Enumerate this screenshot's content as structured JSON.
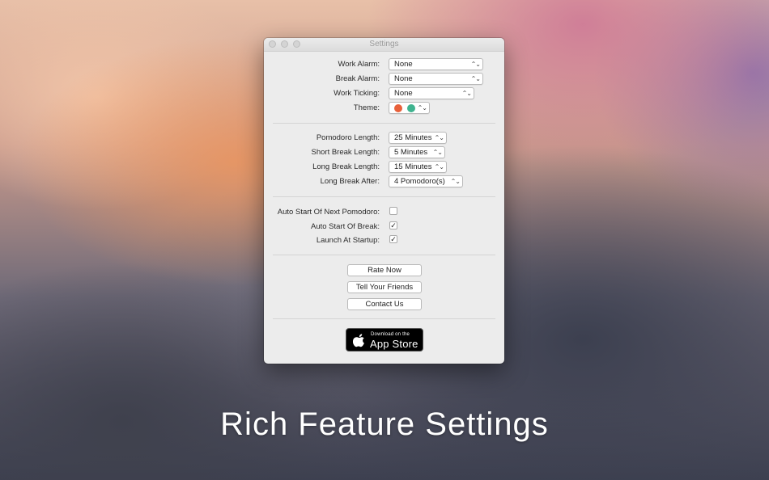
{
  "window": {
    "title": "Settings"
  },
  "alarms": {
    "work_alarm": {
      "label": "Work Alarm:",
      "value": "None"
    },
    "break_alarm": {
      "label": "Break Alarm:",
      "value": "None"
    },
    "work_ticking": {
      "label": "Work Ticking:",
      "value": "None"
    },
    "theme": {
      "label": "Theme:",
      "colors": [
        "#e8603a",
        "#3fb38f"
      ]
    }
  },
  "durations": {
    "pomodoro_length": {
      "label": "Pomodoro Length:",
      "value": "25 Minutes"
    },
    "short_break_length": {
      "label": "Short Break Length:",
      "value": "5 Minutes"
    },
    "long_break_length": {
      "label": "Long Break Length:",
      "value": "15 Minutes"
    },
    "long_break_after": {
      "label": "Long Break After:",
      "value": "4 Pomodoro(s)"
    }
  },
  "options": {
    "auto_start_pomodoro": {
      "label": "Auto Start Of Next Pomodoro:",
      "checked": false
    },
    "auto_start_break": {
      "label": "Auto Start Of Break:",
      "checked": true,
      "mark": "✓"
    },
    "launch_at_startup": {
      "label": "Launch At Startup:",
      "checked": true,
      "mark": "✓"
    }
  },
  "actions": {
    "rate_now": "Rate Now",
    "tell_friends": "Tell Your Friends",
    "contact_us": "Contact Us"
  },
  "app_store_badge": {
    "line1": "Download on the",
    "line2": "App Store"
  },
  "headline": "Rich Feature Settings"
}
